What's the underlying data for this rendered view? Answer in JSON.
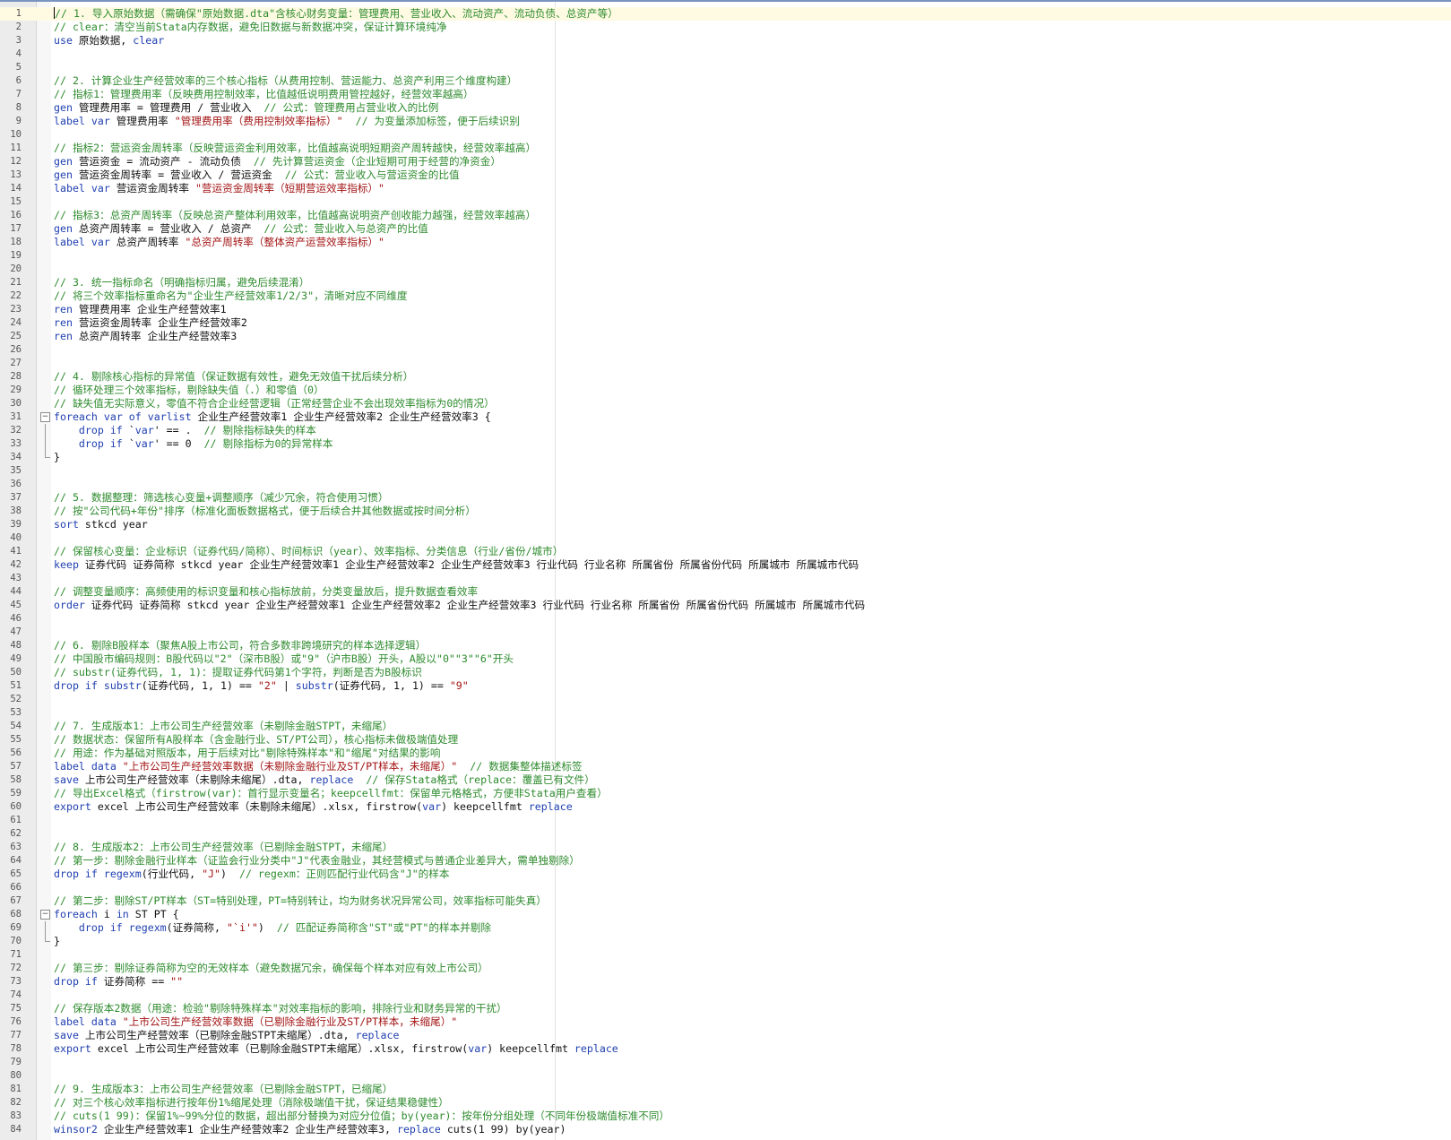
{
  "editor": {
    "current_line": 1,
    "lines": [
      [
        [
          "c",
          "// 1. 导入原始数据（需确保\"原始数据.dta\"含核心财务变量：管理费用、营业收入、流动资产、流动负债、总资产等）"
        ]
      ],
      [
        [
          "c",
          "// clear：清空当前Stata内存数据，避免旧数据与新数据冲突，保证计算环境纯净"
        ]
      ],
      [
        [
          "k",
          "use"
        ],
        [
          "t",
          " 原始数据, "
        ],
        [
          "k",
          "clear"
        ]
      ],
      [],
      [],
      [
        [
          "c",
          "// 2. 计算企业生产经营效率的三个核心指标（从费用控制、营运能力、总资产利用三个维度构建）"
        ]
      ],
      [
        [
          "c",
          "// 指标1：管理费用率（反映费用控制效率，比值越低说明费用管控越好，经营效率越高）"
        ]
      ],
      [
        [
          "k",
          "gen"
        ],
        [
          "t",
          " 管理费用率 = 管理费用 / 营业收入  "
        ],
        [
          "c",
          "// 公式：管理费用占营业收入的比例"
        ]
      ],
      [
        [
          "k",
          "label var"
        ],
        [
          "t",
          " 管理费用率 "
        ],
        [
          "s",
          "\"管理费用率（费用控制效率指标）\""
        ],
        [
          "t",
          "  "
        ],
        [
          "c",
          "// 为变量添加标签，便于后续识别"
        ]
      ],
      [],
      [
        [
          "c",
          "// 指标2：营运资金周转率（反映营运资金利用效率，比值越高说明短期资产周转越快，经营效率越高）"
        ]
      ],
      [
        [
          "k",
          "gen"
        ],
        [
          "t",
          " 营运资金 = 流动资产 - 流动负债  "
        ],
        [
          "c",
          "// 先计算营运资金（企业短期可用于经营的净资金）"
        ]
      ],
      [
        [
          "k",
          "gen"
        ],
        [
          "t",
          " 营运资金周转率 = 营业收入 / 营运资金  "
        ],
        [
          "c",
          "// 公式：营业收入与营运资金的比值"
        ]
      ],
      [
        [
          "k",
          "label var"
        ],
        [
          "t",
          " 营运资金周转率 "
        ],
        [
          "s",
          "\"营运资金周转率（短期营运效率指标）\""
        ]
      ],
      [],
      [
        [
          "c",
          "// 指标3：总资产周转率（反映总资产整体利用效率，比值越高说明资产创收能力越强，经营效率越高）"
        ]
      ],
      [
        [
          "k",
          "gen"
        ],
        [
          "t",
          " 总资产周转率 = 营业收入 / 总资产  "
        ],
        [
          "c",
          "// 公式：营业收入与总资产的比值"
        ]
      ],
      [
        [
          "k",
          "label var"
        ],
        [
          "t",
          " 总资产周转率 "
        ],
        [
          "s",
          "\"总资产周转率（整体资产运营效率指标）\""
        ]
      ],
      [],
      [],
      [
        [
          "c",
          "// 3. 统一指标命名（明确指标归属，避免后续混淆）"
        ]
      ],
      [
        [
          "c",
          "// 将三个效率指标重命名为\"企业生产经营效率1/2/3\"，清晰对应不同维度"
        ]
      ],
      [
        [
          "k",
          "ren"
        ],
        [
          "t",
          " 管理费用率 企业生产经营效率1"
        ]
      ],
      [
        [
          "k",
          "ren"
        ],
        [
          "t",
          " 营运资金周转率 企业生产经营效率2"
        ]
      ],
      [
        [
          "k",
          "ren"
        ],
        [
          "t",
          " 总资产周转率 企业生产经营效率3"
        ]
      ],
      [],
      [],
      [
        [
          "c",
          "// 4. 剔除核心指标的异常值（保证数据有效性，避免无效值干扰后续分析）"
        ]
      ],
      [
        [
          "c",
          "// 循环处理三个效率指标，剔除缺失值（.）和零值（0）"
        ]
      ],
      [
        [
          "c",
          "// 缺失值无实际意义，零值不符合企业经营逻辑（正常经营企业不会出现效率指标为0的情况）"
        ]
      ],
      [
        [
          "k",
          "foreach"
        ],
        [
          "t",
          " "
        ],
        [
          "k",
          "var"
        ],
        [
          "t",
          " "
        ],
        [
          "k",
          "of"
        ],
        [
          "t",
          " "
        ],
        [
          "k",
          "varlist"
        ],
        [
          "t",
          " 企业生产经营效率1 企业生产经营效率2 企业生产经营效率3 {"
        ]
      ],
      [
        [
          "t",
          "    "
        ],
        [
          "k",
          "drop if"
        ],
        [
          "t",
          " `"
        ],
        [
          "k",
          "var"
        ],
        [
          "t",
          "' == .  "
        ],
        [
          "c",
          "// 剔除指标缺失的样本"
        ]
      ],
      [
        [
          "t",
          "    "
        ],
        [
          "k",
          "drop if"
        ],
        [
          "t",
          " `"
        ],
        [
          "k",
          "var"
        ],
        [
          "t",
          "' == 0  "
        ],
        [
          "c",
          "// 剔除指标为0的异常样本"
        ]
      ],
      [
        [
          "t",
          "}"
        ]
      ],
      [],
      [],
      [
        [
          "c",
          "// 5. 数据整理：筛选核心变量+调整顺序（减少冗余，符合使用习惯）"
        ]
      ],
      [
        [
          "c",
          "// 按\"公司代码+年份\"排序（标准化面板数据格式，便于后续合并其他数据或按时间分析）"
        ]
      ],
      [
        [
          "k",
          "sort"
        ],
        [
          "t",
          " stkcd year"
        ]
      ],
      [],
      [
        [
          "c",
          "// 保留核心变量：企业标识（证券代码/简称）、时间标识（year）、效率指标、分类信息（行业/省份/城市）"
        ]
      ],
      [
        [
          "k",
          "keep"
        ],
        [
          "t",
          " 证券代码 证券简称 stkcd year 企业生产经营效率1 企业生产经营效率2 企业生产经营效率3 行业代码 行业名称 所属省份 所属省份代码 所属城市 所属城市代码"
        ]
      ],
      [],
      [
        [
          "c",
          "// 调整变量顺序：高频使用的标识变量和核心指标放前，分类变量放后，提升数据查看效率"
        ]
      ],
      [
        [
          "k",
          "order"
        ],
        [
          "t",
          " 证券代码 证券简称 stkcd year 企业生产经营效率1 企业生产经营效率2 企业生产经营效率3 行业代码 行业名称 所属省份 所属省份代码 所属城市 所属城市代码"
        ]
      ],
      [],
      [],
      [
        [
          "c",
          "// 6. 剔除B股样本（聚焦A股上市公司，符合多数非跨境研究的样本选择逻辑）"
        ]
      ],
      [
        [
          "c",
          "// 中国股市编码规则：B股代码以\"2\"（深市B股）或\"9\"（沪市B股）开头，A股以\"0\"\"3\"\"6\"开头"
        ]
      ],
      [
        [
          "c",
          "// substr(证券代码, 1, 1)：提取证券代码第1个字符，判断是否为B股标识"
        ]
      ],
      [
        [
          "k",
          "drop if"
        ],
        [
          "t",
          " "
        ],
        [
          "k",
          "substr"
        ],
        [
          "t",
          "(证券代码, 1, 1) == "
        ],
        [
          "s",
          "\"2\""
        ],
        [
          "t",
          " | "
        ],
        [
          "k",
          "substr"
        ],
        [
          "t",
          "(证券代码, 1, 1) == "
        ],
        [
          "s",
          "\"9\""
        ]
      ],
      [],
      [],
      [
        [
          "c",
          "// 7. 生成版本1：上市公司生产经营效率（未剔除金融STPT，未缩尾）"
        ]
      ],
      [
        [
          "c",
          "// 数据状态：保留所有A股样本（含金融行业、ST/PT公司），核心指标未做极端值处理"
        ]
      ],
      [
        [
          "c",
          "// 用途：作为基础对照版本，用于后续对比\"剔除特殊样本\"和\"缩尾\"对结果的影响"
        ]
      ],
      [
        [
          "k",
          "label data"
        ],
        [
          "t",
          " "
        ],
        [
          "s",
          "\"上市公司生产经营效率数据（未剔除金融行业及ST/PT样本，未缩尾）\""
        ],
        [
          "t",
          "  "
        ],
        [
          "c",
          "// 数据集整体描述标签"
        ]
      ],
      [
        [
          "k",
          "save"
        ],
        [
          "t",
          " 上市公司生产经营效率（未剔除未缩尾）.dta, "
        ],
        [
          "k",
          "replace"
        ],
        [
          "t",
          "  "
        ],
        [
          "c",
          "// 保存Stata格式（replace：覆盖已有文件）"
        ]
      ],
      [
        [
          "c",
          "// 导出Excel格式（firstrow(var)：首行显示变量名；keepcellfmt：保留单元格格式，方便非Stata用户查看）"
        ]
      ],
      [
        [
          "k",
          "export"
        ],
        [
          "t",
          " excel 上市公司生产经营效率（未剔除未缩尾）.xlsx, firstrow("
        ],
        [
          "k",
          "var"
        ],
        [
          "t",
          ") keepcellfmt "
        ],
        [
          "k",
          "replace"
        ]
      ],
      [],
      [],
      [
        [
          "c",
          "// 8. 生成版本2：上市公司生产经营效率（已剔除金融STPT，未缩尾）"
        ]
      ],
      [
        [
          "c",
          "// 第一步：剔除金融行业样本（证监会行业分类中\"J\"代表金融业，其经营模式与普通企业差异大，需单独剔除）"
        ]
      ],
      [
        [
          "k",
          "drop if"
        ],
        [
          "t",
          " "
        ],
        [
          "k",
          "regexm"
        ],
        [
          "t",
          "(行业代码, "
        ],
        [
          "s",
          "\"J\""
        ],
        [
          "t",
          ")  "
        ],
        [
          "c",
          "// regexm：正则匹配行业代码含\"J\"的样本"
        ]
      ],
      [],
      [
        [
          "c",
          "// 第二步：剔除ST/PT样本（ST=特别处理，PT=特别转让，均为财务状况异常公司，效率指标可能失真）"
        ]
      ],
      [
        [
          "k",
          "foreach"
        ],
        [
          "t",
          " i "
        ],
        [
          "k",
          "in"
        ],
        [
          "t",
          " ST PT {"
        ]
      ],
      [
        [
          "t",
          "    "
        ],
        [
          "k",
          "drop if"
        ],
        [
          "t",
          " "
        ],
        [
          "k",
          "regexm"
        ],
        [
          "t",
          "(证券简称, "
        ],
        [
          "s",
          "\"`i'\""
        ],
        [
          "t",
          ")  "
        ],
        [
          "c",
          "// 匹配证券简称含\"ST\"或\"PT\"的样本并剔除"
        ]
      ],
      [
        [
          "t",
          "}"
        ]
      ],
      [],
      [
        [
          "c",
          "// 第三步：剔除证券简称为空的无效样本（避免数据冗余，确保每个样本对应有效上市公司）"
        ]
      ],
      [
        [
          "k",
          "drop if"
        ],
        [
          "t",
          " 证券简称 == "
        ],
        [
          "s",
          "\"\""
        ]
      ],
      [],
      [
        [
          "c",
          "// 保存版本2数据（用途：检验\"剔除特殊样本\"对效率指标的影响，排除行业和财务异常的干扰）"
        ]
      ],
      [
        [
          "k",
          "label data"
        ],
        [
          "t",
          " "
        ],
        [
          "s",
          "\"上市公司生产经营效率数据（已剔除金融行业及ST/PT样本，未缩尾）\""
        ]
      ],
      [
        [
          "k",
          "save"
        ],
        [
          "t",
          " 上市公司生产经营效率（已剔除金融STPT未缩尾）.dta, "
        ],
        [
          "k",
          "replace"
        ]
      ],
      [
        [
          "k",
          "export"
        ],
        [
          "t",
          " excel 上市公司生产经营效率（已剔除金融STPT未缩尾）.xlsx, firstrow("
        ],
        [
          "k",
          "var"
        ],
        [
          "t",
          ") keepcellfmt "
        ],
        [
          "k",
          "replace"
        ]
      ],
      [],
      [],
      [
        [
          "c",
          "// 9. 生成版本3：上市公司生产经营效率（已剔除金融STPT，已缩尾）"
        ]
      ],
      [
        [
          "c",
          "// 对三个核心效率指标进行按年份1%缩尾处理（消除极端值干扰，保证结果稳健性）"
        ]
      ],
      [
        [
          "c",
          "// cuts(1 99)：保留1%~99%分位的数据，超出部分替换为对应分位值；by(year)：按年份分组处理（不同年份极端值标准不同）"
        ]
      ],
      [
        [
          "k",
          "winsor2"
        ],
        [
          "t",
          " 企业生产经营效率1 企业生产经营效率2 企业生产经营效率3, "
        ],
        [
          "k",
          "replace"
        ],
        [
          "t",
          " cuts(1 99) by(year)"
        ]
      ]
    ]
  }
}
